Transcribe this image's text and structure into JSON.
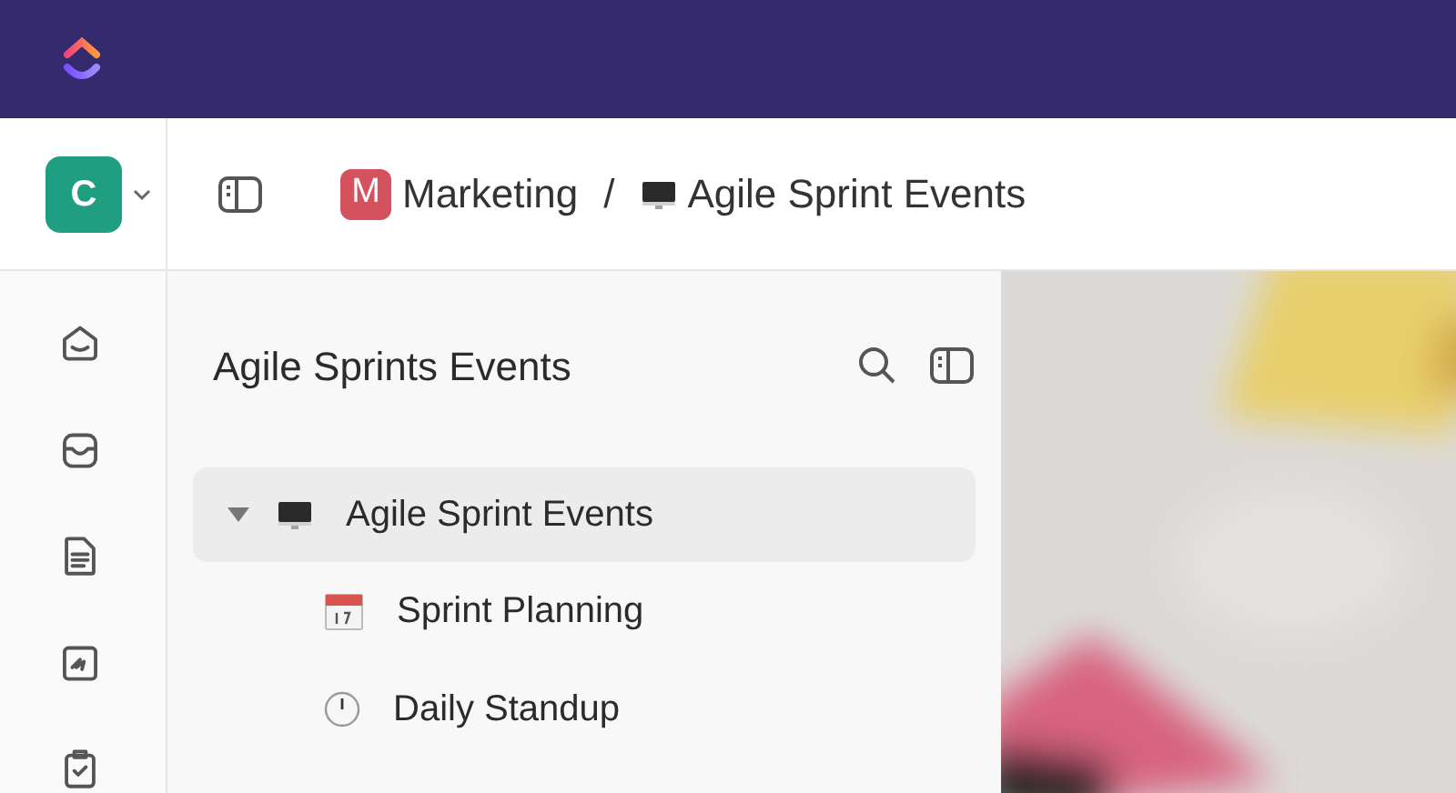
{
  "workspace": {
    "initial": "C"
  },
  "breadcrumb": [
    {
      "badge": "M",
      "label": "Marketing",
      "kind": "space"
    },
    {
      "label": "Agile Sprint Events",
      "kind": "monitor"
    }
  ],
  "separator": "/",
  "sidebar": {
    "title": "Agile Sprints Events",
    "tree": [
      {
        "label": "Agile Sprint Events",
        "kind": "monitor",
        "expanded": true,
        "selected": true,
        "children": [
          {
            "label": "Sprint Planning",
            "kind": "calendar",
            "selected": false
          },
          {
            "label": "Daily Standup",
            "kind": "clock",
            "selected": false
          }
        ]
      }
    ]
  }
}
